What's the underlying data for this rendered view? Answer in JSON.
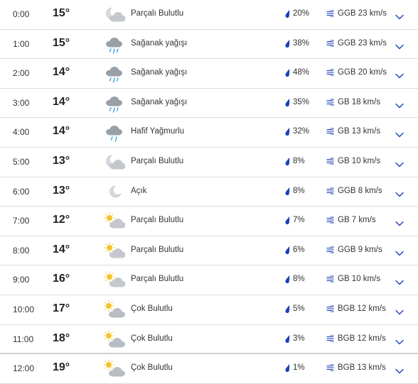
{
  "hours": [
    {
      "time": "0:00",
      "temp": "15°",
      "icon": "partly-cloudy-night-icon",
      "condition": "Parçalı Bulutlu",
      "precip": "20%",
      "wind": "GGB 23 km/s"
    },
    {
      "time": "1:00",
      "temp": "15°",
      "icon": "showers-icon",
      "condition": "Sağanak yağışı",
      "precip": "38%",
      "wind": "GGB 23 km/s"
    },
    {
      "time": "2:00",
      "temp": "14°",
      "icon": "showers-icon",
      "condition": "Sağanak yağışı",
      "precip": "48%",
      "wind": "GGB 20 km/s"
    },
    {
      "time": "3:00",
      "temp": "14°",
      "icon": "showers-icon",
      "condition": "Sağanak yağışı",
      "precip": "35%",
      "wind": "GB 18 km/s"
    },
    {
      "time": "4:00",
      "temp": "14°",
      "icon": "light-rain-icon",
      "condition": "Hafif Yağmurlu",
      "precip": "32%",
      "wind": "GB 13 km/s"
    },
    {
      "time": "5:00",
      "temp": "13°",
      "icon": "partly-cloudy-night-icon",
      "condition": "Parçalı Bulutlu",
      "precip": "8%",
      "wind": "GB 10 km/s"
    },
    {
      "time": "6:00",
      "temp": "13°",
      "icon": "clear-night-icon",
      "condition": "Açık",
      "precip": "8%",
      "wind": "GGB 8 km/s"
    },
    {
      "time": "7:00",
      "temp": "12°",
      "icon": "partly-cloudy-day-icon",
      "condition": "Parçalı Bulutlu",
      "precip": "7%",
      "wind": "GB 7 km/s"
    },
    {
      "time": "8:00",
      "temp": "14°",
      "icon": "partly-cloudy-day-icon",
      "condition": "Parçalı Bulutlu",
      "precip": "6%",
      "wind": "GGB 9 km/s"
    },
    {
      "time": "9:00",
      "temp": "16°",
      "icon": "partly-cloudy-day-icon",
      "condition": "Parçalı Bulutlu",
      "precip": "8%",
      "wind": "GB 10 km/s"
    },
    {
      "time": "10:00",
      "temp": "17°",
      "icon": "mostly-cloudy-day-icon",
      "condition": "Çok Bulutlu",
      "precip": "5%",
      "wind": "BGB 12 km/s"
    },
    {
      "time": "11:00",
      "temp": "18°",
      "icon": "mostly-cloudy-day-icon",
      "condition": "Çok Bulutlu",
      "precip": "3%",
      "wind": "BGB 12 km/s"
    },
    {
      "time": "12:00",
      "temp": "19°",
      "icon": "mostly-cloudy-day-icon",
      "condition": "Çok Bulutlu",
      "precip": "1%",
      "wind": "BGB 13 km/s"
    }
  ],
  "colors": {
    "drop": "#1a3fb8",
    "wind": "#1a3fb8",
    "chevron": "#1a3fb8",
    "cloud": "#c4c8ce",
    "sun": "#f5c32a",
    "rain": "#3aa0e0",
    "moon": "#d6d9de"
  }
}
